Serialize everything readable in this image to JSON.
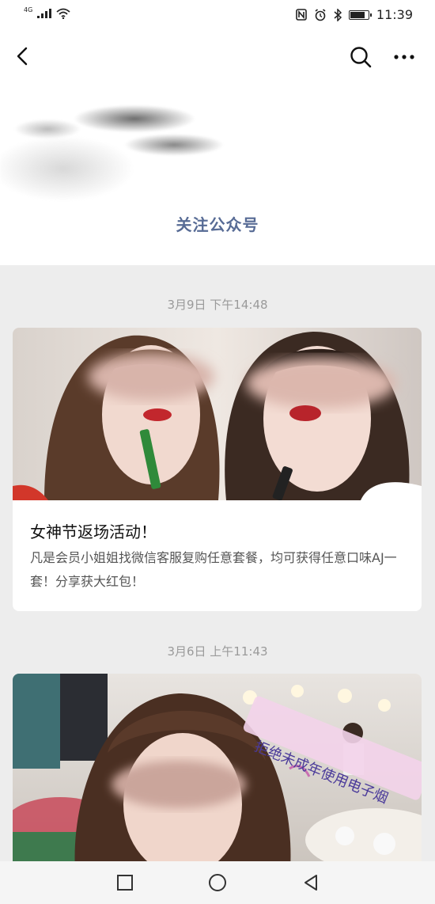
{
  "status_bar": {
    "network_label": "4G",
    "time": "11:39",
    "battery_level_percent": 85,
    "icons": [
      "signal-icon",
      "wifi-icon",
      "nfc-icon",
      "alarm-icon",
      "bluetooth-icon",
      "battery-icon"
    ]
  },
  "header": {
    "follow_label": "关注公众号",
    "icons": {
      "back": "back-arrow-icon",
      "search": "search-icon",
      "more": "more-icon"
    }
  },
  "feed": [
    {
      "timestamp": "3月9日 下午14:48",
      "title": "女神节返场活动！",
      "description": "凡是会员小姐姐找微信客服复购任意套餐，均可获得任意口味AJ一套！分享获大红包！"
    },
    {
      "timestamp": "3月6日 上午11:43",
      "overlay_text": "拒绝未成年使用电子烟"
    }
  ],
  "nav_bar": {
    "icons": [
      "recent-apps-icon",
      "home-icon",
      "back-icon"
    ]
  },
  "colors": {
    "accent_link": "#576b95",
    "background": "#ededed",
    "card": "#ffffff",
    "timestamp": "#9a9a9a"
  }
}
